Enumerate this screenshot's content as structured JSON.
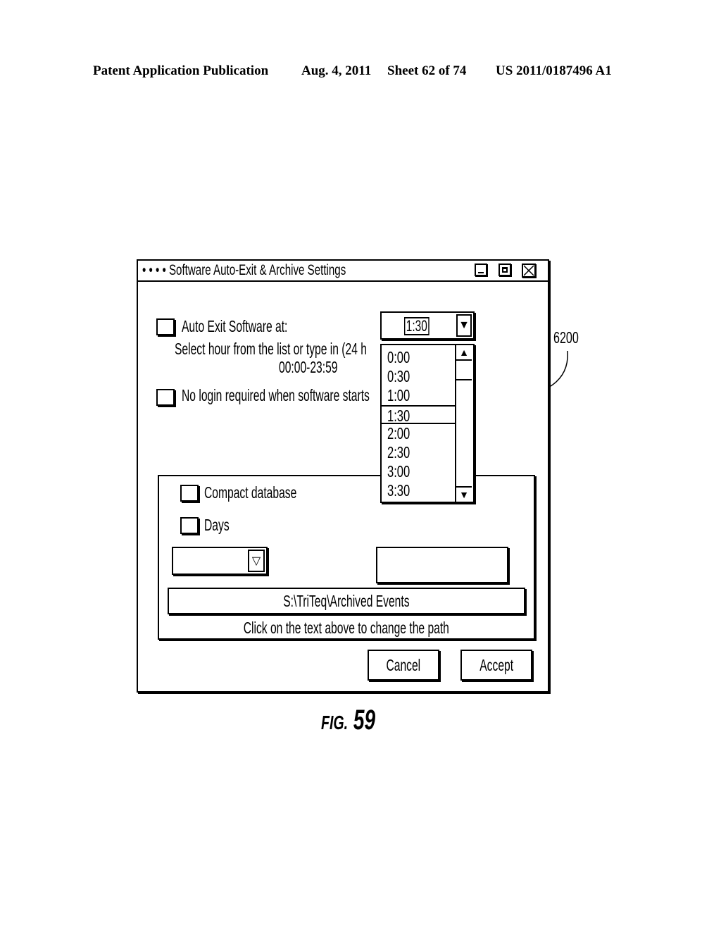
{
  "header": {
    "publication": "Patent Application Publication",
    "date": "Aug. 4, 2011",
    "sheet": "Sheet 62 of 74",
    "number": "US 2011/0187496 A1"
  },
  "window": {
    "title": "• • • • Software Auto-Exit & Archive Settings",
    "controls": [
      "minimize-icon",
      "maximize-icon",
      "close-icon"
    ]
  },
  "auto_exit": {
    "checkbox_label": "Auto Exit Software at:",
    "checked": false,
    "hint_line1": "Select hour from the list or type in (24 h",
    "hint_line2": "00:00-23:59",
    "selected_time": "1:30",
    "dropdown_arrow": "▼"
  },
  "time_list": {
    "items": [
      "0:00",
      "0:30",
      "1:00",
      "1:30",
      "2:00",
      "2:30",
      "3:00",
      "3:30"
    ],
    "selected": "1:30",
    "scroll_up": "▲",
    "scroll_down": "▼"
  },
  "no_login": {
    "checkbox_label": "No login required when software starts",
    "checked": false
  },
  "archive": {
    "compact_label": "Compact database",
    "days_label": "Days",
    "days_dropdown_value": "",
    "days_dropdown_arrow": "▽",
    "text_field_value": "",
    "path": "S:\\TriTeq\\Archived Events",
    "path_hint": "Click on the text above to change the path"
  },
  "buttons": {
    "cancel": "Cancel",
    "accept": "Accept"
  },
  "reference_numeral": "6200",
  "figure": {
    "prefix": "FIG.",
    "number": "59"
  }
}
